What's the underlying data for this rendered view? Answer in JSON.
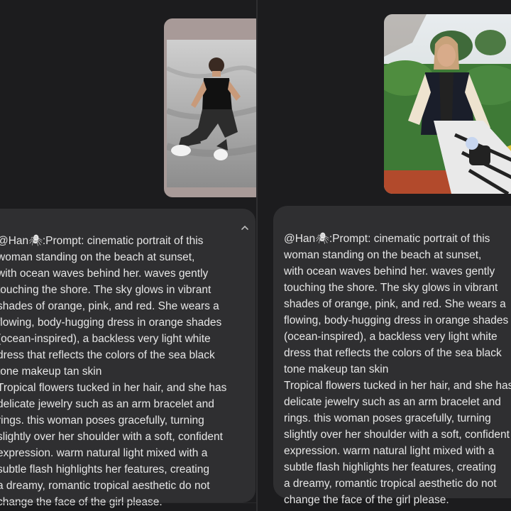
{
  "left_message": {
    "photo": {
      "description_icon": "photo-icon"
    },
    "prompt_text": "@Han🕷:Prompt: cinematic portrait of this\nwoman standing on the beach at sunset,\nwith ocean waves behind her. waves gently\ntouching the shore. The sky glows in vibrant\nshades of orange, pink, and red. She wears a\nflowing, body-hugging dress in orange shades\n(ocean-inspired), a backless very light white\ndress that reflects the colors of the sea black\ntone makeup tan skin\nTropical flowers tucked in her hair, and she has\ndelicate jewelry such as an arm bracelet and\nrings. this woman poses gracefully, turning\nslightly over her shoulder with a soft, confident\nexpression. warm natural light mixed with a\nsubtle flash highlights her features, creating\na dreamy, romantic tropical aesthetic do not\nchange the face of the girl please.",
    "collapse_icon": "chevron-up-icon"
  },
  "right_message": {
    "photo": {
      "description_icon": "photo-icon"
    },
    "prompt_text": "@Han🕷:Prompt: cinematic portrait of this\nwoman standing on the beach at sunset,\nwith ocean waves behind her. waves gently\ntouching the shore. The sky glows in vibrant\nshades of orange, pink, and red. She wears a\nflowing, body-hugging dress in orange shades\n(ocean-inspired), a backless very light white\ndress that reflects the colors of the sea black\ntone makeup tan skin\nTropical flowers tucked in her hair, and she has\ndelicate jewelry such as an arm bracelet and\nrings. this woman poses gracefully, turning\nslightly over her shoulder with a soft, confident\nexpression. warm natural light mixed with a\nsubtle flash highlights her features, creating\na dreamy, romantic tropical aesthetic do not\nchange the face of the girl please."
  },
  "colors": {
    "background": "#1c1c1e",
    "bubble": "#2f2f31",
    "text": "#e6e6e6"
  }
}
